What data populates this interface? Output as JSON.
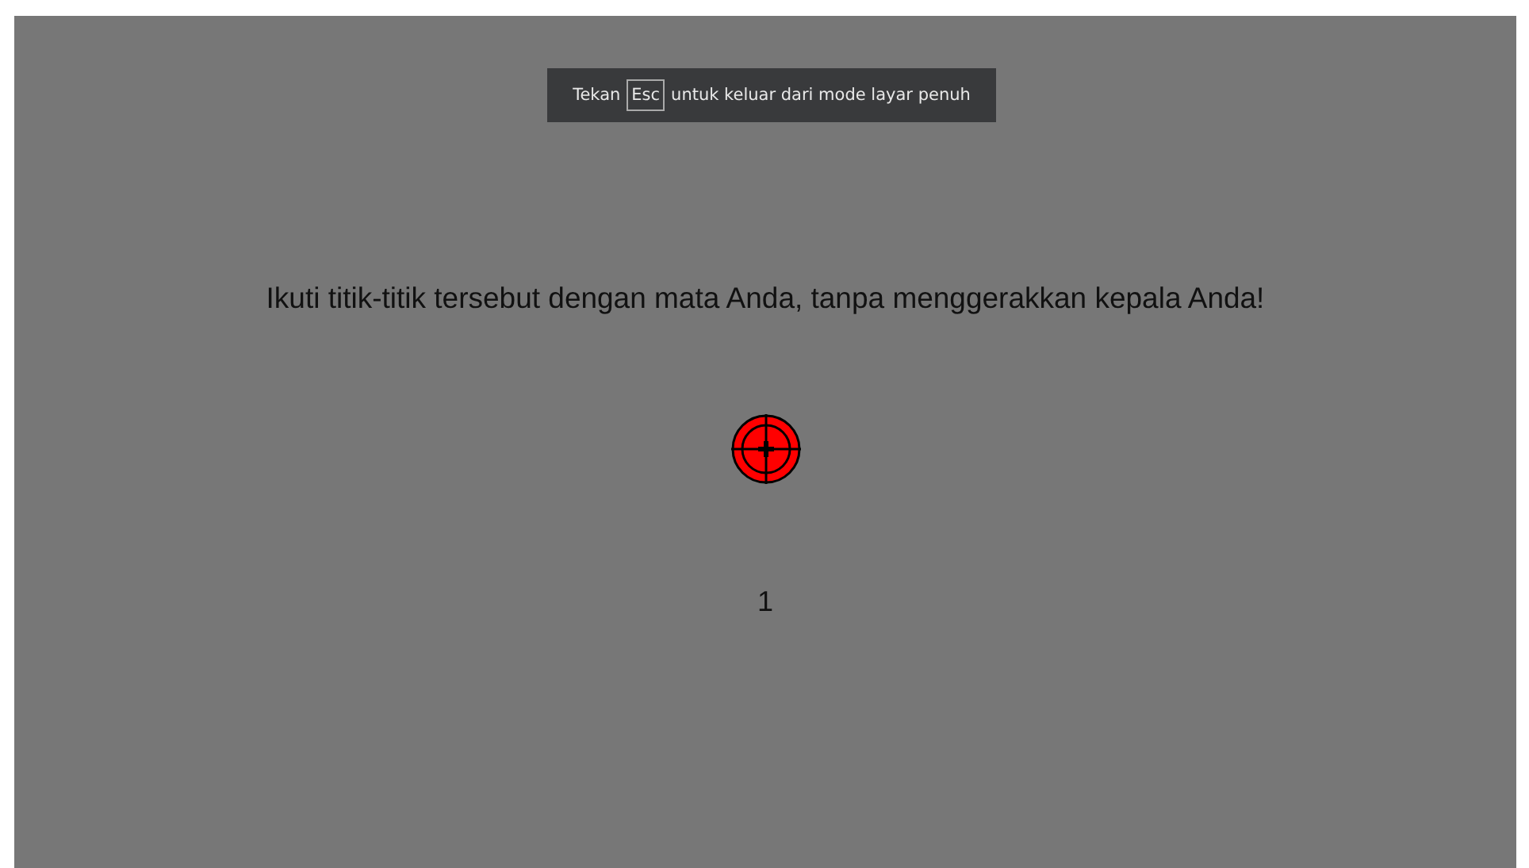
{
  "fullscreen_notice": {
    "before": "Tekan",
    "key": "Esc",
    "after": "untuk keluar dari mode layar penuh"
  },
  "instruction": "Ikuti titik-titik tersebut dengan mata Anda, tanpa menggerakkan kepala Anda!",
  "counter": "1"
}
